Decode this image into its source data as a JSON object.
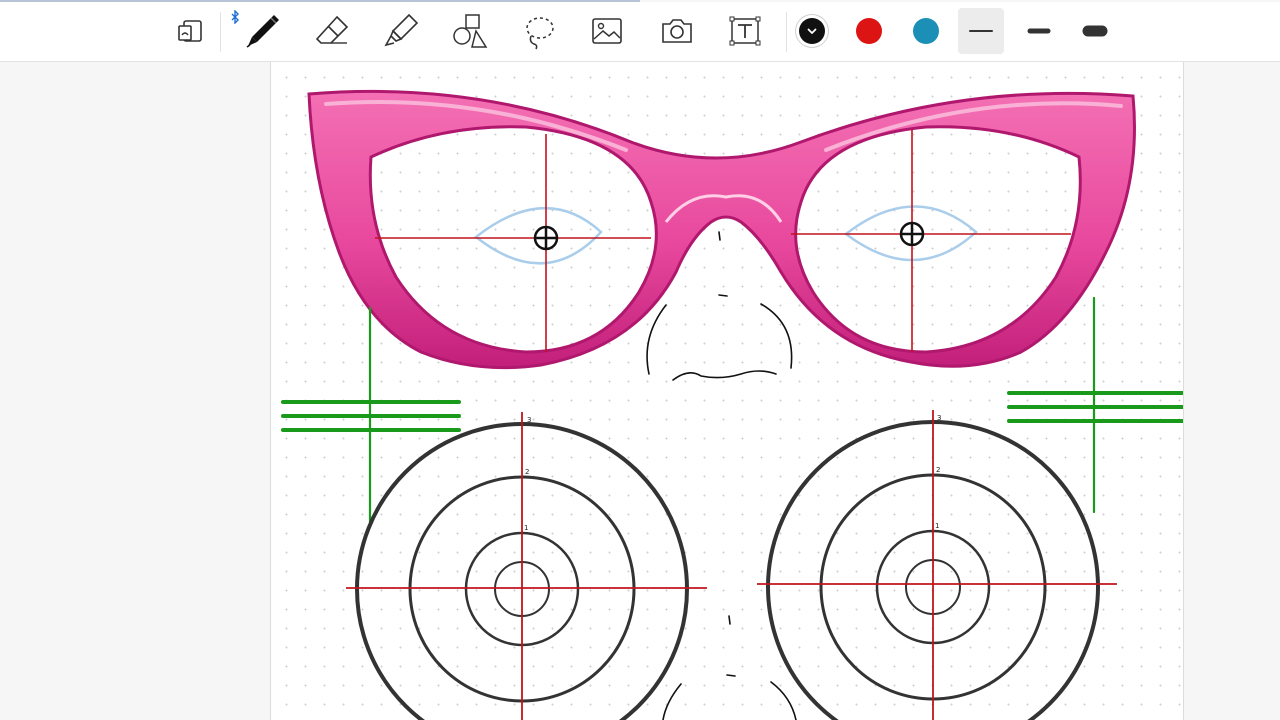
{
  "toolbar": {
    "tools": [
      {
        "name": "page-view-icon"
      },
      {
        "name": "pen-icon",
        "bluetooth": true
      },
      {
        "name": "eraser-icon"
      },
      {
        "name": "highlighter-icon"
      },
      {
        "name": "shapes-icon"
      },
      {
        "name": "lasso-icon"
      },
      {
        "name": "image-icon"
      },
      {
        "name": "camera-icon"
      },
      {
        "name": "text-icon"
      }
    ],
    "colors": [
      {
        "name": "black",
        "hex": "#111111",
        "selected": true
      },
      {
        "name": "red",
        "hex": "#dd1414",
        "selected": false
      },
      {
        "name": "teal",
        "hex": "#1b8fb5",
        "selected": false
      }
    ],
    "stroke_widths": [
      {
        "name": "thin",
        "selected": true
      },
      {
        "name": "medium",
        "selected": false
      },
      {
        "name": "thick",
        "selected": false
      }
    ]
  },
  "canvas": {
    "page_background": "#ffffff",
    "frame_color": "#e84a9f",
    "frame_dark": "#b0186e",
    "crosshair_color": "#c0141c",
    "eye_outline_color": "#a9cdea",
    "guide_color": "#1a9a1a",
    "target_labels": [
      "3",
      "2",
      "1"
    ]
  }
}
